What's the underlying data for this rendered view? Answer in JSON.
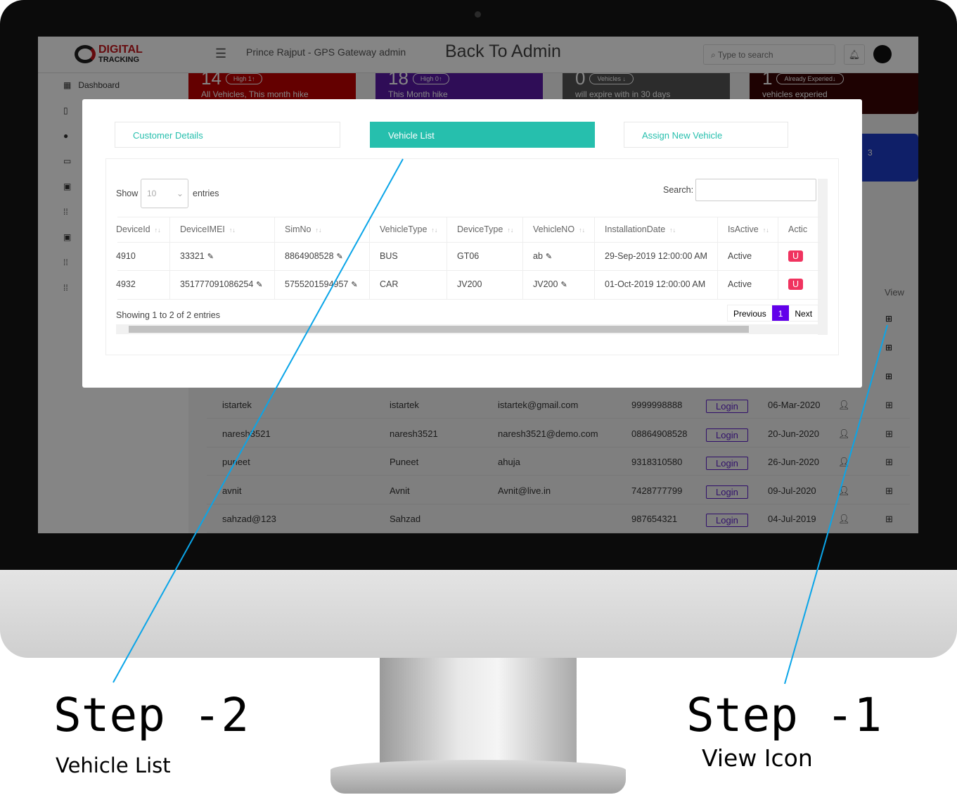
{
  "header": {
    "logo_top": "DIGITAL",
    "logo_bottom": "TRACKING",
    "title": "Prince Rajput - GPS Gateway admin",
    "back_link": "Back To Admin",
    "search_placeholder": "Type to search"
  },
  "sidebar": {
    "items": [
      {
        "label": "Dashboard",
        "icon": "dashboard-icon"
      }
    ]
  },
  "cards": [
    {
      "num": "14",
      "pill": "High  1↑",
      "text": "All Vehicles, This month hike",
      "color": "#c00000"
    },
    {
      "num": "18",
      "pill": "High  0↑",
      "text": "This Month hike",
      "color": "#5a1aa8"
    },
    {
      "num": "0",
      "pill": "Vehicles  ↓",
      "text": "will expire with in 30 days",
      "color": "#555555"
    },
    {
      "num": "1",
      "pill": "Already  Experied↓",
      "text": "vehicles experied",
      "color": "#3a0505"
    },
    {
      "num": "3",
      "pill": "",
      "text": "",
      "color": "#1e3cc8"
    }
  ],
  "background_table": {
    "view_header": "View",
    "rows": [
      [
        "istartek",
        "istartek",
        "istartek@gmail.com",
        "9999998888",
        "Login",
        "06-Mar-2020"
      ],
      [
        "naresh3521",
        "naresh3521",
        "naresh3521@demo.com",
        "08864908528",
        "Login",
        "20-Jun-2020"
      ],
      [
        "puneet",
        "Puneet",
        "ahuja",
        "9318310580",
        "Login",
        "26-Jun-2020"
      ],
      [
        "avnit",
        "Avnit",
        "Avnit@live.in",
        "7428777799",
        "Login",
        "09-Jul-2020"
      ],
      [
        "sahzad@123",
        "Sahzad",
        "",
        "987654321",
        "Login",
        "04-Jul-2019"
      ]
    ]
  },
  "modal": {
    "tabs": [
      "Customer Details",
      "Vehicle List",
      "Assign New Vehicle"
    ],
    "active_tab": "Vehicle List",
    "show_label": "Show",
    "entries_value": "10",
    "entries_label": "entries",
    "search_label": "Search:",
    "search_value": "",
    "columns": [
      "DeviceId",
      "DeviceIMEI",
      "SimNo",
      "VehicleType",
      "DeviceType",
      "VehicleNO",
      "InstallationDate",
      "IsActive",
      "Actic"
    ],
    "rows": [
      [
        "4910",
        "33321",
        "8864908528",
        "BUS",
        "GT06",
        "ab",
        "29-Sep-2019 12:00:00 AM",
        "Active",
        "U"
      ],
      [
        "4932",
        "351777091086254",
        "5755201594957",
        "CAR",
        "JV200",
        "JV200",
        "01-Oct-2019 12:00:00 AM",
        "Active",
        "U"
      ]
    ],
    "info": "Showing 1 to 2 of 2 entries",
    "pagination": {
      "previous": "Previous",
      "current": "1",
      "next": "Next"
    }
  },
  "annotations": {
    "step2": "Step -2",
    "step2_sub": "Vehicle List",
    "step1": "Step -1",
    "step1_sub": "View Icon",
    "line_color": "#0aa5e8"
  }
}
